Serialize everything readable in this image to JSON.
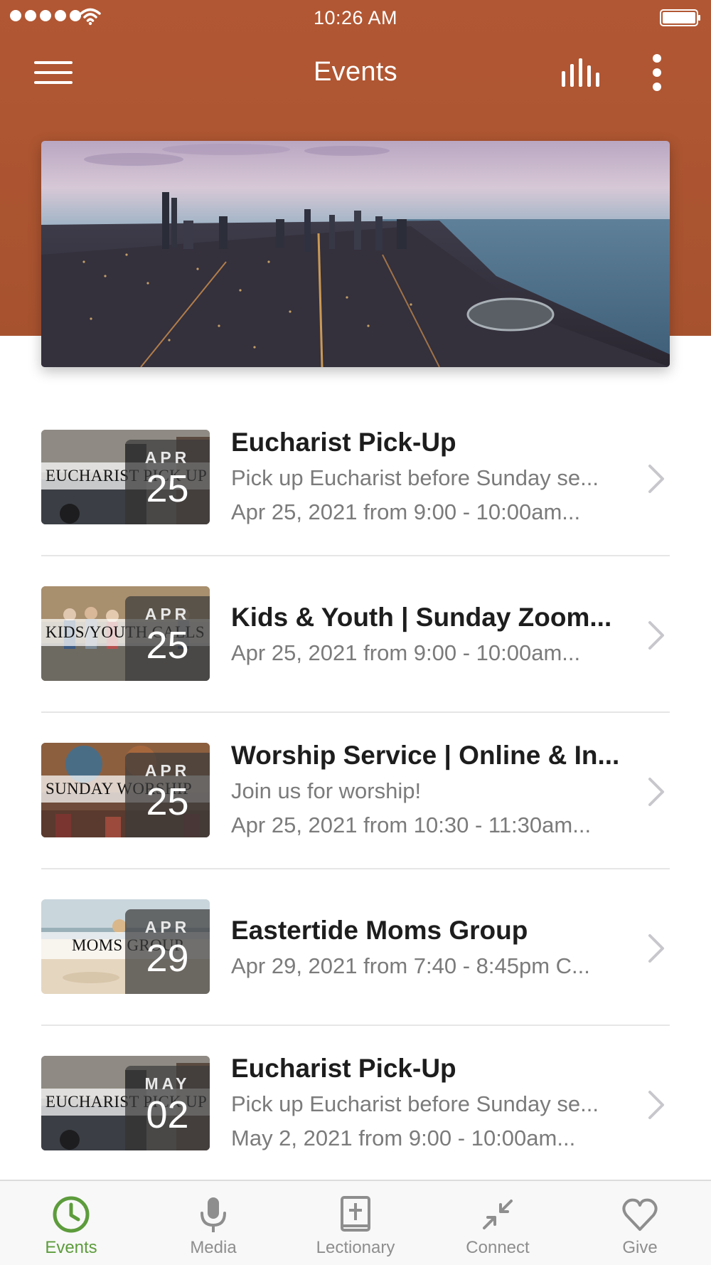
{
  "status_bar": {
    "time": "10:26 AM"
  },
  "nav": {
    "title": "Events"
  },
  "colors": {
    "header": "#b25733",
    "active_tab": "#5d9c3c",
    "inactive_tab": "#8e8e8e"
  },
  "events": [
    {
      "thumb_caption": "EUCHARIST PICK UP",
      "month": "APR",
      "day": "25",
      "title": "Eucharist Pick-Up",
      "lines": [
        "Pick up Eucharist before Sunday se...",
        "Apr 25, 2021 from 9:00 - 10:00am..."
      ]
    },
    {
      "thumb_caption": "KIDS/YOUTH CALLS",
      "month": "APR",
      "day": "25",
      "title": "Kids & Youth | Sunday Zoom...",
      "lines": [
        "Apr 25, 2021 from 9:00 - 10:00am..."
      ]
    },
    {
      "thumb_caption": "SUNDAY WORSHIP",
      "month": "APR",
      "day": "25",
      "title": "Worship Service | Online & In...",
      "lines": [
        "Join us for worship!",
        "Apr 25, 2021 from 10:30 - 11:30am..."
      ]
    },
    {
      "thumb_caption": "MOMS GROUP",
      "month": "APR",
      "day": "29",
      "title": "Eastertide Moms Group",
      "lines": [
        "Apr 29, 2021 from 7:40 - 8:45pm C..."
      ]
    },
    {
      "thumb_caption": "EUCHARIST PICK UP",
      "month": "MAY",
      "day": "02",
      "title": "Eucharist Pick-Up",
      "lines": [
        "Pick up Eucharist before Sunday se...",
        "May 2, 2021 from 9:00 - 10:00am..."
      ]
    }
  ],
  "tabs": [
    {
      "label": "Events",
      "icon": "clock-icon",
      "active": true
    },
    {
      "label": "Media",
      "icon": "microphone-icon",
      "active": false
    },
    {
      "label": "Lectionary",
      "icon": "book-icon",
      "active": false
    },
    {
      "label": "Connect",
      "icon": "connect-arrows-icon",
      "active": false
    },
    {
      "label": "Give",
      "icon": "heart-icon",
      "active": false
    }
  ]
}
